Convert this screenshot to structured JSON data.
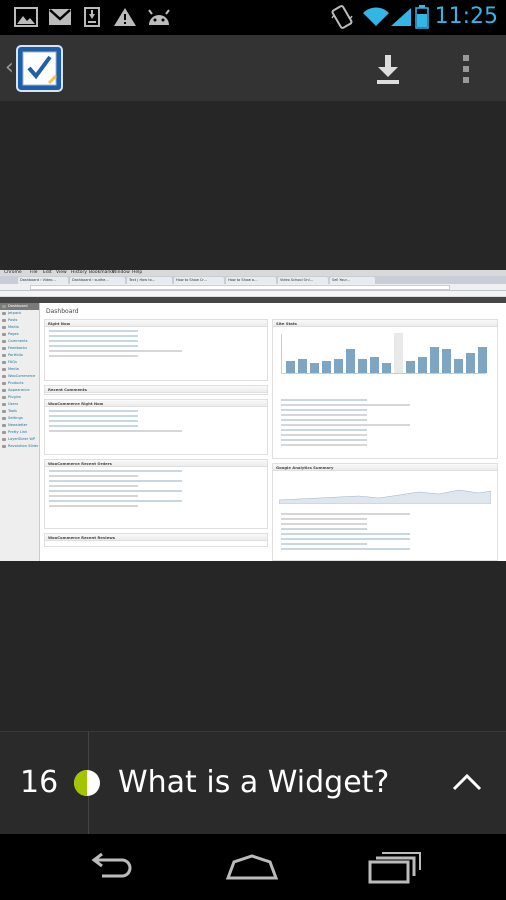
{
  "status_bar": {
    "time": "11:25",
    "left_icons": [
      "image-icon",
      "gmail-icon",
      "download-icon",
      "warning-icon",
      "android-icon"
    ],
    "right_icons": [
      "vibrate-icon",
      "wifi-icon",
      "signal-icon",
      "battery-icon"
    ]
  },
  "action_bar": {
    "app_icon": "checklist-app-icon",
    "actions": [
      "download-icon",
      "overflow-menu-icon"
    ]
  },
  "screenshot": {
    "menu": [
      "Chrome",
      "File",
      "Edit",
      "View",
      "History",
      "Bookmarks",
      "Window",
      "Help"
    ],
    "tabs": [
      "Dashboard ‹ Video…",
      "Dashboard ‹ sudhe…",
      "Text | How to…",
      "How to Show Cr…",
      "How to Show a…",
      "Video School Onl…",
      "Sell Your…"
    ],
    "page_title": "Dashboard",
    "sidebar": [
      "Dashboard",
      "Jetpack",
      "Posts",
      "Media",
      "Pages",
      "Comments",
      "Feedbacks",
      "Portfolio",
      "FAQs",
      "Media",
      "WooCommerce",
      "Products",
      "Appearance",
      "Plugins",
      "Users",
      "Tools",
      "Settings",
      "Newsletter",
      "Pretty Link",
      "LayerSlider WP",
      "Revolution Slider"
    ],
    "panels": [
      "Right Now",
      "Recent Comments",
      "WooCommerce Right Now",
      "WooCommerce Recent Orders",
      "WooCommerce Recent Reviews",
      "Site Stats",
      "Google Analytics Summary"
    ]
  },
  "chapter_bar": {
    "number": "16",
    "progress_icon": "half-circle-progress-icon",
    "title": "What is a Widget?",
    "expand_icon": "chevron-up-icon",
    "accent": "#a4c400"
  },
  "nav_bar": {
    "buttons": [
      "back-icon",
      "home-icon",
      "recent-apps-icon"
    ]
  }
}
